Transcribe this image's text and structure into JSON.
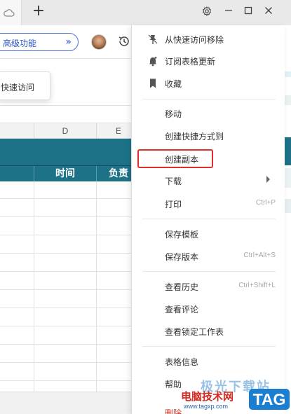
{
  "titlebar": {
    "new_tab_symbol": "+",
    "icons": [
      "cloud-icon",
      "gear-icon",
      "minimize-icon",
      "maximize-icon",
      "close-icon"
    ]
  },
  "toolbar": {
    "advanced_label": "高级功能",
    "advanced_chevron": "»",
    "accent_color": "#2a55c9"
  },
  "popup": {
    "text": "快速访问"
  },
  "sheet": {
    "columns": [
      "D",
      "E"
    ],
    "headers": [
      "时间",
      "负责"
    ],
    "header_color": "#1d7287"
  },
  "menu": {
    "items": [
      {
        "label": "从快速访问移除",
        "icon": "unpin-icon",
        "shortcut": ""
      },
      {
        "label": "订阅表格更新",
        "icon": "bell-icon",
        "shortcut": ""
      },
      {
        "label": "收藏",
        "icon": "bookmark-icon",
        "shortcut": ""
      },
      {
        "label": "移动",
        "icon": "",
        "shortcut": ""
      },
      {
        "label": "创建快捷方式到",
        "icon": "",
        "shortcut": ""
      },
      {
        "label": "创建副本",
        "icon": "",
        "shortcut": "",
        "highlighted": true
      },
      {
        "label": "下载",
        "icon": "",
        "shortcut": "",
        "submenu": true
      },
      {
        "label": "打印",
        "icon": "",
        "shortcut": "Ctrl+P"
      },
      {
        "label": "保存模板",
        "icon": "",
        "shortcut": ""
      },
      {
        "label": "保存版本",
        "icon": "",
        "shortcut": "Ctrl+Alt+S"
      },
      {
        "label": "查看历史",
        "icon": "",
        "shortcut": "Ctrl+Shift+L"
      },
      {
        "label": "查看评论",
        "icon": "",
        "shortcut": ""
      },
      {
        "label": "查看锁定工作表",
        "icon": "",
        "shortcut": ""
      },
      {
        "label": "表格信息",
        "icon": "",
        "shortcut": ""
      },
      {
        "label": "帮助",
        "icon": "",
        "shortcut": ""
      }
    ],
    "partial_delete_label": "删除",
    "highlight_color": "#e22d2d"
  },
  "watermark": {
    "top_text": "极光下载站",
    "site_name": "电脑技术网",
    "url": "www.tagxp.com",
    "badge": "TAG"
  }
}
